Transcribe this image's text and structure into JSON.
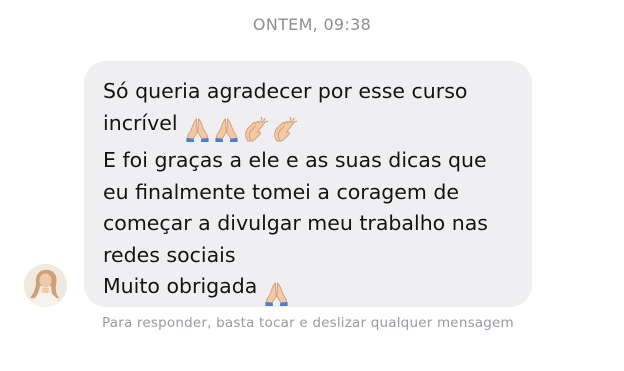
{
  "conversation": {
    "timestamp": "ONTEM, 09:38"
  },
  "message": {
    "lines": [
      "Só queria agradecer por esse curso",
      "incrível",
      "E foi graças a ele e as suas dicas que",
      "eu finalmente tomei a coragem de",
      "começar a divulgar meu trabalho nas",
      "redes sociais",
      "Muito obrigada"
    ],
    "emojis_line2": [
      "folded-hands-icon",
      "folded-hands-icon",
      "clapping-hands-icon",
      "clapping-hands-icon"
    ],
    "emojis_line7": [
      "folded-hands-icon"
    ]
  },
  "hint": {
    "text": "Para responder, basta tocar e deslizar qualquer mensagem"
  }
}
